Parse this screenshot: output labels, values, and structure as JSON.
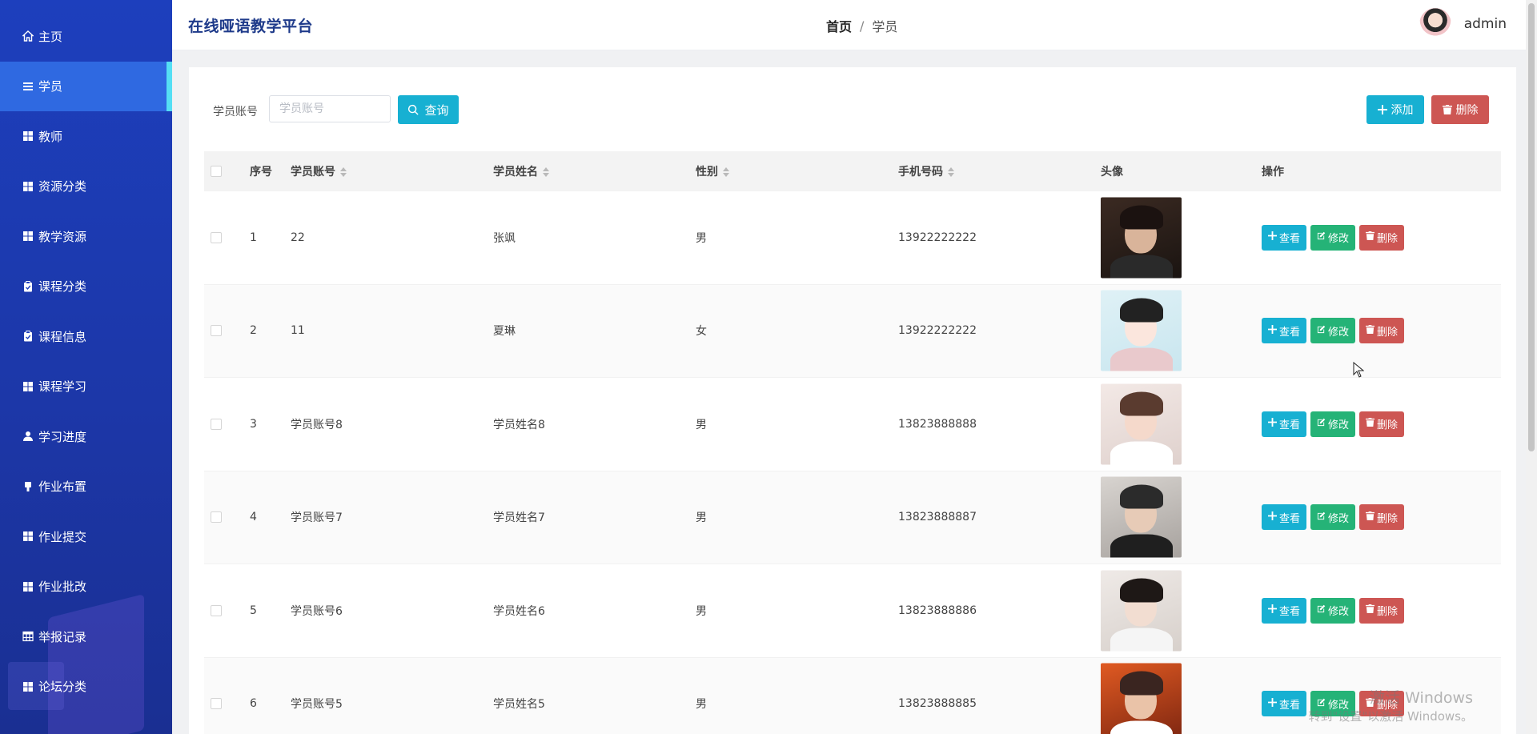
{
  "app": {
    "site_title": "在线哑语教学平台",
    "user": "admin"
  },
  "breadcrumb": {
    "home": "首页",
    "separator": "/",
    "current": "学员"
  },
  "sidebar": {
    "items": [
      {
        "label": "主页",
        "icon": "home-icon"
      },
      {
        "label": "学员",
        "icon": "list-icon",
        "active": true
      },
      {
        "label": "教师",
        "icon": "grid-icon"
      },
      {
        "label": "资源分类",
        "icon": "grid-icon"
      },
      {
        "label": "教学资源",
        "icon": "grid-icon"
      },
      {
        "label": "课程分类",
        "icon": "clipboard-icon"
      },
      {
        "label": "课程信息",
        "icon": "clipboard-icon"
      },
      {
        "label": "课程学习",
        "icon": "grid-icon"
      },
      {
        "label": "学习进度",
        "icon": "user-icon"
      },
      {
        "label": "作业布置",
        "icon": "pin-icon"
      },
      {
        "label": "作业提交",
        "icon": "grid-icon"
      },
      {
        "label": "作业批改",
        "icon": "grid-icon"
      },
      {
        "label": "举报记录",
        "icon": "table-icon"
      },
      {
        "label": "论坛分类",
        "icon": "grid-icon"
      }
    ]
  },
  "search": {
    "label": "学员账号",
    "placeholder": "学员账号",
    "value": "",
    "query_label": "查询"
  },
  "toolbar": {
    "add_label": "添加",
    "delete_label": "删除"
  },
  "table": {
    "columns": [
      "序号",
      "学员账号",
      "学员姓名",
      "性别",
      "手机号码",
      "头像",
      "操作"
    ],
    "sortable": [
      false,
      true,
      true,
      true,
      true,
      false,
      false
    ],
    "actions": {
      "view": "查看",
      "edit": "修改",
      "delete": "删除"
    },
    "rows": [
      {
        "index": "1",
        "account": "22",
        "name": "张飒",
        "gender": "男",
        "phone": "13922222222",
        "avatar": "young man, dark hair, dark background"
      },
      {
        "index": "2",
        "account": "11",
        "name": "夏琳",
        "gender": "女",
        "phone": "13922222222",
        "avatar": "illustrated girl with cat ears"
      },
      {
        "index": "3",
        "account": "学员账号8",
        "name": "学员姓名8",
        "gender": "男",
        "phone": "13823888888",
        "avatar": "woman holding white plush toy"
      },
      {
        "index": "4",
        "account": "学员账号7",
        "name": "学员姓名7",
        "gender": "男",
        "phone": "13823888887",
        "avatar": "young man wearing cap"
      },
      {
        "index": "5",
        "account": "学员账号6",
        "name": "学员姓名6",
        "gender": "男",
        "phone": "13823888886",
        "avatar": "woman with long dark hair"
      },
      {
        "index": "6",
        "account": "学员账号5",
        "name": "学员姓名5",
        "gender": "男",
        "phone": "13823888885",
        "avatar": "young man in orange light"
      }
    ]
  },
  "watermark": {
    "title": "激活 Windows",
    "subtitle": "转到\"设置\"以激活 Windows。"
  },
  "colors": {
    "sidebar_bg": "#1d3fbd",
    "sidebar_active": "#2f69e1",
    "sidebar_active_bar": "#55dff4",
    "primary_button": "#17b0d2",
    "edit_button": "#25b377",
    "danger_button": "#cd5653",
    "title_text": "#1e3a8a"
  }
}
